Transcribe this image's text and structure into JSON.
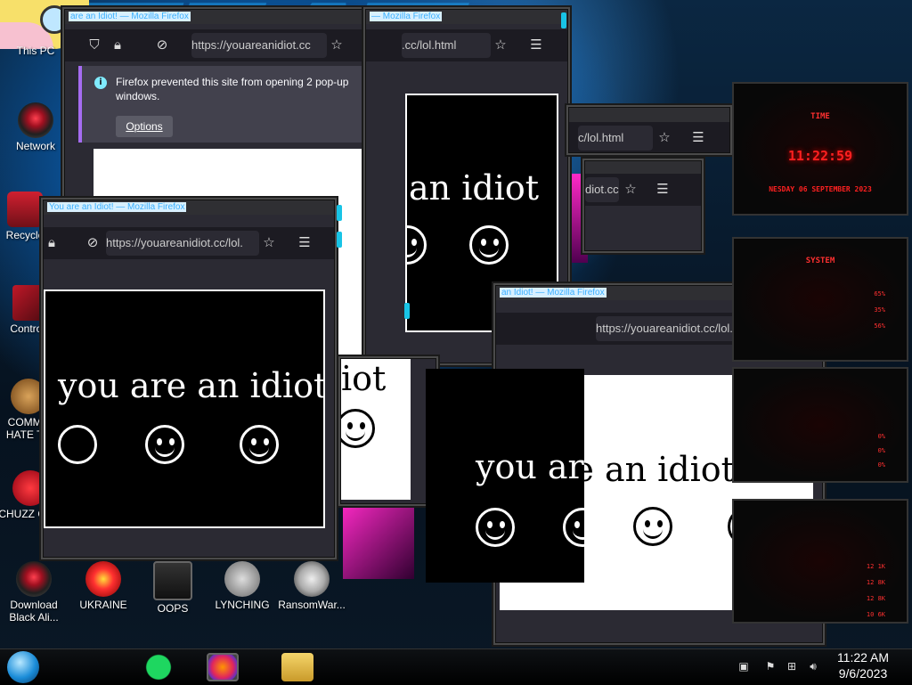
{
  "desktop": {
    "icons": [
      {
        "name": "this-pc",
        "label": "This PC"
      },
      {
        "name": "network",
        "label": "Network"
      },
      {
        "name": "recycle-bin",
        "label": "Recycle"
      },
      {
        "name": "control-panel",
        "label": "Control I"
      },
      {
        "name": "communism",
        "label": "COMMU HATE TH"
      },
      {
        "name": "chuzz",
        "label": "CHUZZ CUM"
      },
      {
        "name": "download-black-alien",
        "label": "Download Black Ali..."
      },
      {
        "name": "ukraine",
        "label": "UKRAINE"
      },
      {
        "name": "oops",
        "label": "OOPS"
      },
      {
        "name": "lynching",
        "label": "LYNCHING"
      },
      {
        "name": "ransomware",
        "label": "RansomWar..."
      }
    ]
  },
  "browser": {
    "window_title_full": "You are an Idiot! — Mozilla Firefox",
    "window_title_a": "are an Idiot! — Mozilla Firefox",
    "window_title_b": "— Mozilla Firefox",
    "window_title_c": "an Idiot! — Mozilla Firefox",
    "url_full": "https://youareanidiot.cc",
    "url_lol": "https://youareanidiot.cc/lol.",
    "url_tail": ".cc/lol.html",
    "url_short": "c/lol.html",
    "url_tiny": "diot.cc",
    "page_text": "you are an idiot",
    "page_text_partial_a": "an idiot",
    "page_text_partial_b": "iot",
    "page_text_partial_c": "you are",
    "page_text_partial_d": "u are an idiot"
  },
  "popup_notice": {
    "message": "Firefox prevented this site from opening 2 pop-up windows.",
    "options_button": "Options"
  },
  "gadget": {
    "time_title": "TIME",
    "clock": "11:22:59",
    "date": "NESDAY 06 SEPTEMBER 2023",
    "system_title": "SYSTEM",
    "cpu_vals": [
      "65%",
      "35%",
      "56%"
    ],
    "mid_vals": [
      "0%",
      "0%",
      "0%"
    ],
    "net_vals": [
      "12 1K",
      "12 8K",
      "12 8K",
      "10 6K"
    ]
  },
  "taskbar": {
    "time": "11:22 AM",
    "date": "9/6/2023"
  },
  "colors": {
    "accent": "#18c4e6",
    "firefox_purple": "#a56cf1",
    "alien_red": "#ff2020"
  }
}
